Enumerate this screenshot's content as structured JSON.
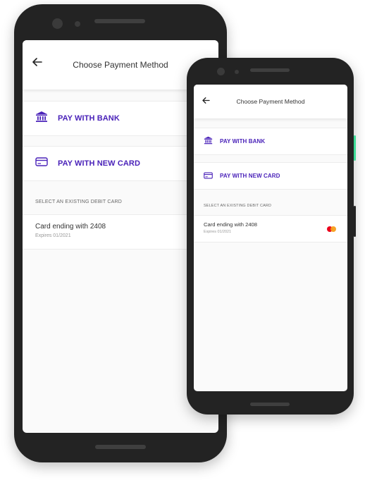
{
  "header": {
    "title": "Choose Payment Method"
  },
  "options": [
    {
      "label": "PAY WITH BANK",
      "icon": "bank-icon"
    },
    {
      "label": "PAY WITH NEW CARD",
      "icon": "credit-card-icon"
    }
  ],
  "existing_section": {
    "label": "SELECT AN EXISTING DEBIT CARD"
  },
  "saved_card": {
    "title": "Card ending with 2408",
    "expiry": "Expires 01/2021",
    "brand_icon": "mastercard-icon"
  },
  "colors": {
    "accent": "#4a22b9",
    "phone_body": "#232323",
    "screen_bg": "#fafafa",
    "side_button_accent": "#3ddc97"
  }
}
